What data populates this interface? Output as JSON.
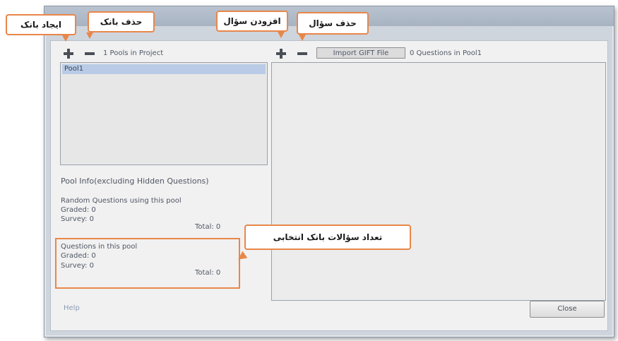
{
  "callouts": {
    "create_bank": "ایجاد بانک",
    "delete_bank": "حذف بانک",
    "add_question": "افزودن سؤال",
    "delete_question": "حذف سؤال",
    "bank_questions_count": "تعداد سؤالات بانک انتخابی"
  },
  "pools": {
    "count_label": "1 Pools in Project",
    "items": [
      "Pool1"
    ]
  },
  "questions": {
    "import_button": "Import GIFT File",
    "count_label": "0 Questions in Pool1"
  },
  "pool_info": {
    "heading": "Pool Info(excluding Hidden Questions)",
    "random_heading": "Random Questions using this pool",
    "random_graded": "Graded:   0",
    "random_survey": "Survey:   0",
    "random_total": "Total:  0",
    "in_pool_heading": "Questions in this pool",
    "in_pool_graded": "Graded:   0",
    "in_pool_survey": "Survey:   0",
    "in_pool_total": "Total:  0"
  },
  "footer": {
    "help": "Help",
    "close": "Close"
  },
  "colors": {
    "callout_border": "#e8874a",
    "dialog_bg": "#f1f1f1",
    "selection": "#b9cbe6"
  }
}
